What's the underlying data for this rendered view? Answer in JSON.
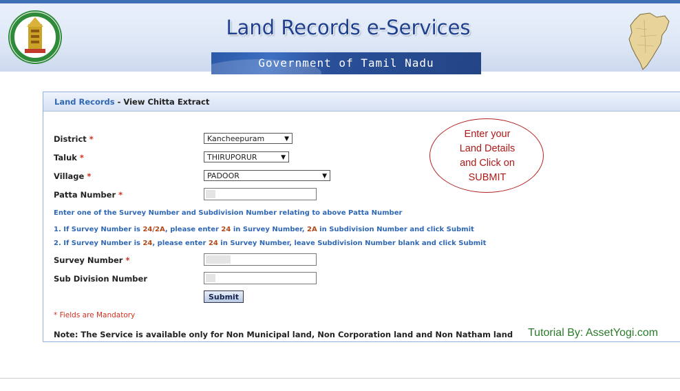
{
  "header": {
    "site_title": "Land Records e-Services",
    "gov_banner": "Government of Tamil Nadu"
  },
  "panel": {
    "breadcrumb_link": "Land Records",
    "breadcrumb_rest": " - View Chitta Extract"
  },
  "form": {
    "district": {
      "label": "District",
      "value": "Kancheepuram"
    },
    "taluk": {
      "label": "Taluk",
      "value": "THIRUPORUR"
    },
    "village": {
      "label": "Village",
      "value": "PADOOR"
    },
    "patta": {
      "label": "Patta Number",
      "value": ""
    },
    "required_mark": "*",
    "instruction": "Enter one of the Survey Number and Subdivision Number relating to above Patta Number",
    "rule1": {
      "a": "1. If Survey Number is ",
      "b": "24/2A",
      "c": ", please enter ",
      "d": "24",
      "e": " in Survey Number, ",
      "f": "2A",
      "g": " in Subdivision Number and click Submit"
    },
    "rule2": {
      "a": "2. If Survey Number is ",
      "b": "24",
      "c": ", please enter ",
      "d": "24",
      "e": " in Survey Number, leave Subdivision Number blank and click Submit"
    },
    "survey": {
      "label": "Survey Number",
      "value": ""
    },
    "subdivision": {
      "label": "Sub Division Number",
      "value": ""
    },
    "submit_label": "Submit",
    "mandatory_note": "* Fields are Mandatory",
    "service_note": "Note: The Service is available only for Non Municipal land, Non Corporation land and Non Natham land"
  },
  "callout": {
    "line1": "Enter your",
    "line2": "Land Details",
    "line3": "and Click on",
    "line4": "SUBMIT"
  },
  "tutorial_credit": "Tutorial By: AssetYogi.com",
  "colors": {
    "brand_blue": "#1f3f8f",
    "link_blue": "#2f67b5",
    "required_red": "#d0301f",
    "highlight": "#b04a1a",
    "credit_green": "#2a7a2a"
  }
}
